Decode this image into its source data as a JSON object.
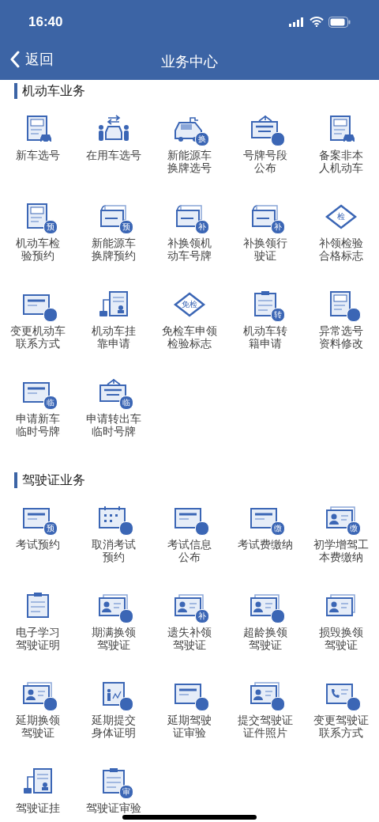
{
  "status_bar": {
    "time": "16:40"
  },
  "nav": {
    "back": "返回",
    "title": "业务中心"
  },
  "sections": [
    {
      "title": "机动车业务",
      "items": [
        {
          "lines": [
            "新车选号"
          ],
          "kind": "doc-car"
        },
        {
          "lines": [
            "在用车选号"
          ],
          "kind": "people-car"
        },
        {
          "lines": [
            "新能源车",
            "换牌选号"
          ],
          "kind": "car",
          "badge": "换"
        },
        {
          "lines": [
            "号牌号段",
            "公布"
          ],
          "kind": "sign",
          "badged": true
        },
        {
          "lines": [
            "备案非本",
            "人机动车"
          ],
          "kind": "doc-car"
        },
        {
          "lines": [
            "机动车检",
            "验预约"
          ],
          "kind": "doc",
          "badge": "预"
        },
        {
          "lines": [
            "新能源车",
            "换牌预约"
          ],
          "kind": "plate",
          "badge": "预"
        },
        {
          "lines": [
            "补换领机",
            "动车号牌"
          ],
          "kind": "plate",
          "badge": "补"
        },
        {
          "lines": [
            "补换领行",
            "驶证"
          ],
          "kind": "plate",
          "badge": "补"
        },
        {
          "lines": [
            "补领检验",
            "合格标志"
          ],
          "kind": "diamond",
          "badge": "检"
        },
        {
          "lines": [
            "变更机动车",
            "联系方式"
          ],
          "kind": "card",
          "badged": true
        },
        {
          "lines": [
            "机动车挂",
            "靠申请"
          ],
          "kind": "trailer-doc"
        },
        {
          "lines": [
            "免检车申领",
            "检验标志"
          ],
          "kind": "diamond",
          "badge": "免检"
        },
        {
          "lines": [
            "机动车转",
            "籍申请"
          ],
          "kind": "clipboard",
          "badge": "转"
        },
        {
          "lines": [
            "异常选号",
            "资料修改"
          ],
          "kind": "doc",
          "badged": true
        },
        {
          "lines": [
            "申请新车",
            "临时号牌"
          ],
          "kind": "card",
          "badge": "临"
        },
        {
          "lines": [
            "申请转出车",
            "临时号牌"
          ],
          "kind": "sign",
          "badge": "临"
        }
      ]
    },
    {
      "title": "驾驶证业务",
      "items": [
        {
          "lines": [
            "考试预约"
          ],
          "kind": "card",
          "badge": "预"
        },
        {
          "lines": [
            "取消考试",
            "预约"
          ],
          "kind": "calendar",
          "badged": true
        },
        {
          "lines": [
            "考试信息",
            "公布"
          ],
          "kind": "card",
          "badged": true
        },
        {
          "lines": [
            "考试费缴纳"
          ],
          "kind": "card",
          "badge": "缴"
        },
        {
          "lines": [
            "初学增驾工",
            "本费缴纳"
          ],
          "kind": "id-card",
          "badge": "缴"
        },
        {
          "lines": [
            "电子学习",
            "驾驶证明"
          ],
          "kind": "clipboard"
        },
        {
          "lines": [
            "期满换领",
            "驾驶证"
          ],
          "kind": "id-card",
          "badged": true
        },
        {
          "lines": [
            "遗失补领",
            "驾驶证"
          ],
          "kind": "id-card",
          "badge": "补"
        },
        {
          "lines": [
            "超龄换领",
            "驾驶证"
          ],
          "kind": "id-card",
          "badged": true
        },
        {
          "lines": [
            "损毁换领",
            "驾驶证"
          ],
          "kind": "id-card"
        },
        {
          "lines": [
            "延期换领",
            "驾驶证"
          ],
          "kind": "id-card",
          "badged": true
        },
        {
          "lines": [
            "延期提交",
            "身体证明"
          ],
          "kind": "person-doc",
          "badged": true
        },
        {
          "lines": [
            "延期驾驶",
            "证审验"
          ],
          "kind": "card",
          "badged": true
        },
        {
          "lines": [
            "提交驾驶证",
            "证件照片"
          ],
          "kind": "id-card",
          "badged": true
        },
        {
          "lines": [
            "变更驾驶证",
            "联系方式"
          ],
          "kind": "phone-card",
          "badged": true
        },
        {
          "lines": [
            "驾驶证挂"
          ],
          "kind": "trailer-doc"
        },
        {
          "lines": [
            "驾驶证审验"
          ],
          "kind": "clipboard",
          "badge": "审"
        }
      ]
    }
  ]
}
